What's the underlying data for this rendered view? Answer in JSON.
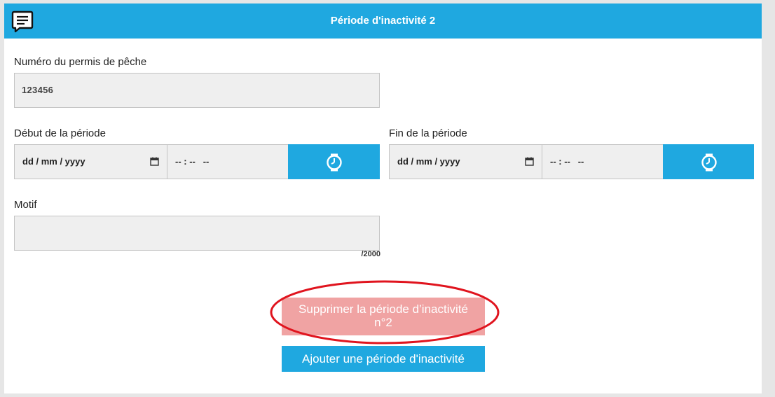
{
  "header": {
    "title": "Période d'inactivité 2",
    "icon": "chat-message-icon",
    "background": "#1fa8e0"
  },
  "form": {
    "permit": {
      "label": "Numéro du permis de pêche",
      "value": "123456"
    },
    "start": {
      "label": "Début de la période",
      "date_placeholder": "dd / mm / yyyy",
      "time_placeholder": "-- : --   --",
      "calendar_icon": "calendar-icon",
      "clock_icon": "clock-icon"
    },
    "end": {
      "label": "Fin de la période",
      "date_placeholder": "dd / mm / yyyy",
      "time_placeholder": "-- : --   --",
      "calendar_icon": "calendar-icon",
      "clock_icon": "clock-icon"
    },
    "motif": {
      "label": "Motif",
      "value": "",
      "counter": "/2000"
    }
  },
  "actions": {
    "delete_line1": "Supprimer la période d’inactivité",
    "delete_line2": "n°2",
    "add_label": "Ajouter une période d'inactivité"
  },
  "colors": {
    "accent": "#1fa8e0",
    "delete_button": "#f0a3a3",
    "highlight_ring": "#e0141e",
    "field_background": "#efefef"
  }
}
